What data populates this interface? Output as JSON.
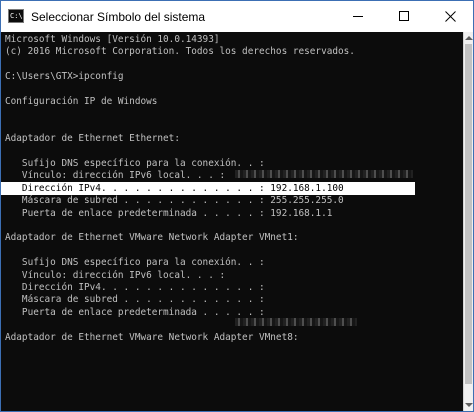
{
  "window": {
    "title": "Seleccionar Símbolo del sistema",
    "icon_label": "C:\\"
  },
  "console": {
    "lines": [
      "Microsoft Windows [Versión 10.0.14393]",
      "(c) 2016 Microsoft Corporation. Todos los derechos reservados.",
      "",
      "C:\\Users\\GTX>ipconfig",
      "",
      "Configuración IP de Windows",
      "",
      "",
      "Adaptador de Ethernet Ethernet:",
      "",
      "   Sufijo DNS específico para la conexión. . :",
      "   Vínculo: dirección IPv6 local. . . :",
      "   Dirección IPv4. . . . . . . . . . . . . . : 192.168.1.100",
      "   Máscara de subred . . . . . . . . . . . . : 255.255.255.0",
      "   Puerta de enlace predeterminada . . . . . : 192.168.1.1",
      "",
      "Adaptador de Ethernet VMware Network Adapter VMnet1:",
      "",
      "   Sufijo DNS específico para la conexión. . :",
      "   Vínculo: dirección IPv6 local. . . :",
      "   Dirección IPv4. . . . . . . . . . . . . . :",
      "   Máscara de subred . . . . . . . . . . . . :",
      "   Puerta de enlace predeterminada . . . . . :",
      "",
      "Adaptador de Ethernet VMware Network Adapter VMnet8:"
    ],
    "highlighted_line_index": 12
  },
  "colors": {
    "console_bg": "#0c0c0c",
    "console_text": "#c0c0c0",
    "selection_bg": "#ffffff",
    "selection_text": "#000000",
    "window_border": "#3c6fb4"
  },
  "icons": {
    "app": "cmd-icon",
    "minimize": "minimize-icon",
    "maximize": "maximize-icon",
    "close": "close-icon"
  }
}
